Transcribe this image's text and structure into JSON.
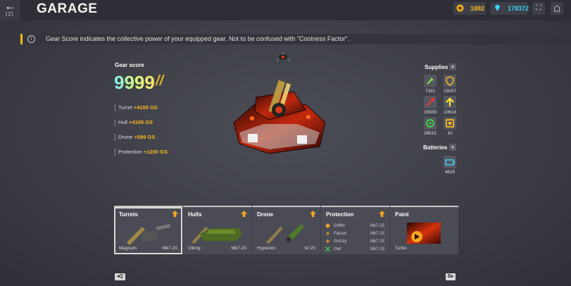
{
  "header": {
    "back_key": "[Z]",
    "title": "GARAGE",
    "crystals": "1882",
    "gems": "178372",
    "crystal_color": "#f5b81c",
    "gem_color": "#3fd0f5"
  },
  "info": {
    "text": "Gear Score indicates the collective power of your equipped gear. Not to be confused with \"Coolness Factor\"."
  },
  "gear_score": {
    "label": "Gear score",
    "value": "9999",
    "stats": [
      {
        "name": "Turret",
        "value": "+4100 GS"
      },
      {
        "name": "Hull",
        "value": "+4100 GS"
      },
      {
        "name": "Drone",
        "value": "+599 GS"
      },
      {
        "name": "Protection",
        "value": "+1200 GS"
      }
    ]
  },
  "supplies": {
    "title": "Supplies",
    "items": [
      {
        "icon": "repair-kit-icon",
        "count": "7331"
      },
      {
        "icon": "armor-icon",
        "count": "15007"
      },
      {
        "icon": "damage-icon",
        "count": "15509"
      },
      {
        "icon": "speed-icon",
        "count": "10618"
      },
      {
        "icon": "mine-icon",
        "count": "29015"
      },
      {
        "icon": "gold-box-icon",
        "count": "10"
      }
    ]
  },
  "batteries": {
    "title": "Batteries",
    "count": "4625"
  },
  "cards": {
    "turrets": {
      "title": "Turrets",
      "item": "Magnum",
      "level": "Mk7-20"
    },
    "hulls": {
      "title": "Hulls",
      "item": "Viking",
      "level": "Mk7-20"
    },
    "drone": {
      "title": "Drone",
      "item": "Hyperion",
      "level": "lvl 20"
    },
    "protection": {
      "title": "Protection",
      "rows": [
        {
          "name": "Griffin",
          "level": "Mk7-15"
        },
        {
          "name": "Falcon",
          "level": "Mk7-15"
        },
        {
          "name": "Grizzly",
          "level": "Mk7-15"
        },
        {
          "name": "Owl",
          "level": "Mk7-15"
        }
      ]
    },
    "paint": {
      "title": "Paint",
      "item": "Turbo"
    }
  },
  "nav": {
    "prev": "Q",
    "next": "E"
  }
}
